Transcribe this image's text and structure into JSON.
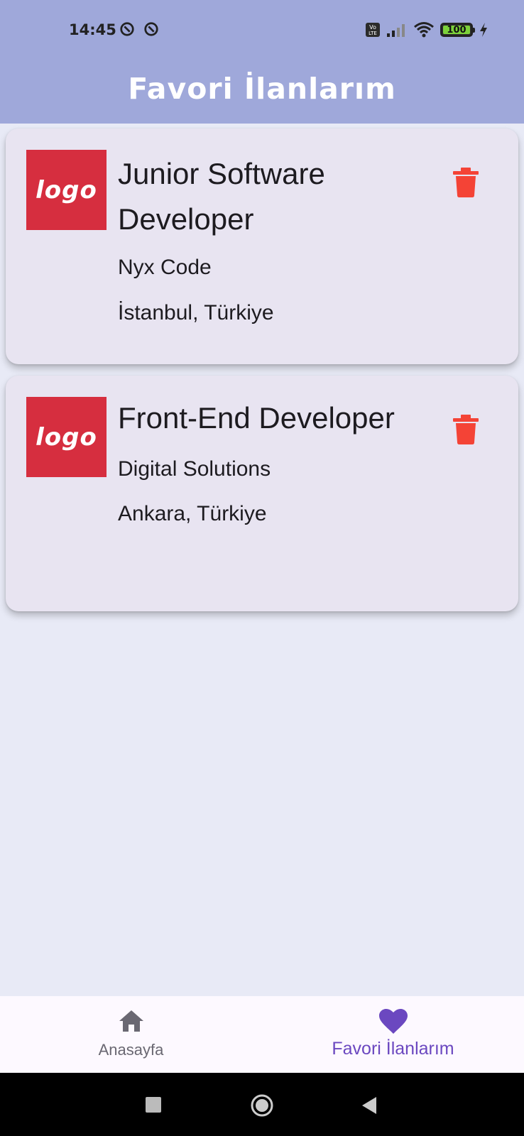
{
  "status_bar": {
    "time": "14:45",
    "battery_level": "100",
    "icons": [
      "notification-icon",
      "notification-icon",
      "volte-icon",
      "signal-icon",
      "wifi-icon",
      "battery-icon",
      "charging-icon"
    ]
  },
  "app_bar": {
    "title": "Favori İlanlarım"
  },
  "favorites": [
    {
      "logo_text": "logo",
      "title": "Junior Software Developer",
      "company": "Nyx Code",
      "location": "İstanbul, Türkiye",
      "action_icon": "trash-icon"
    },
    {
      "logo_text": "logo",
      "title": "Front-End Developer",
      "company": "Digital Solutions",
      "location": "Ankara, Türkiye",
      "action_icon": "trash-icon"
    }
  ],
  "bottom_nav": {
    "items": [
      {
        "label": "Anasayfa",
        "icon": "home-icon",
        "selected": false
      },
      {
        "label": "Favori İlanlarım",
        "icon": "heart-icon",
        "selected": true
      }
    ]
  },
  "colors": {
    "app_bar": "#9fa8da",
    "background": "#e8eaf6",
    "card": "#e8e4f1",
    "logo_bg": "#d62e3f",
    "delete": "#f44336",
    "nav_selected": "#6b48c0"
  },
  "system_nav": [
    "recents-button",
    "home-button",
    "back-button"
  ]
}
